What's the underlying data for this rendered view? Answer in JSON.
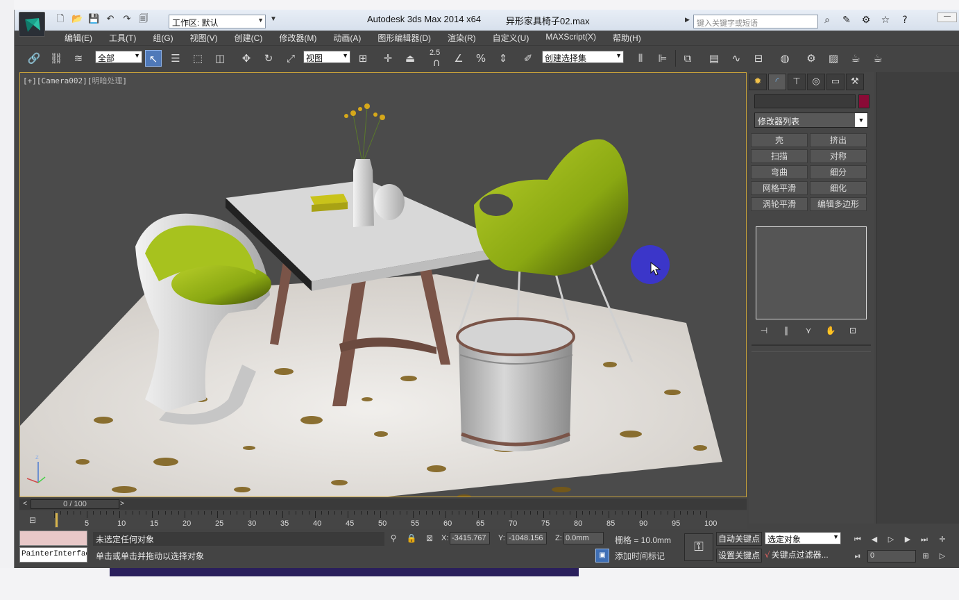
{
  "title": {
    "app": "Autodesk 3ds Max  2014 x64",
    "file": "异形家具椅子02.max",
    "workspace": "工作区: 默认",
    "search_placeholder": "键入关键字或短语",
    "min_label": "—"
  },
  "menu": [
    "编辑(E)",
    "工具(T)",
    "组(G)",
    "视图(V)",
    "创建(C)",
    "修改器(M)",
    "动画(A)",
    "图形编辑器(D)",
    "渲染(R)",
    "自定义(U)",
    "MAXScript(X)",
    "帮助(H)"
  ],
  "toolbar": {
    "filter": "全部",
    "ref_coord": "视图",
    "snap_value": "2.5",
    "selection_set": "创建选择集"
  },
  "viewport": {
    "label_open": "[+][Camera002][",
    "label_shade": "明暗处理",
    "label_close": "]"
  },
  "command_panel": {
    "modifier_list": "修改器列表",
    "modifiers": [
      "壳",
      "挤出",
      "扫描",
      "对称",
      "弯曲",
      "细分",
      "网格平滑",
      "细化",
      "涡轮平滑",
      "编辑多边形"
    ]
  },
  "timeline": {
    "position": "0 / 100",
    "ticks": [
      5,
      10,
      15,
      20,
      25,
      30,
      35,
      40,
      45,
      50,
      55,
      60,
      65,
      70,
      75,
      80,
      85,
      90,
      95,
      100
    ]
  },
  "status": {
    "listener": "PainterInterface",
    "prompt_selection": "未选定任何对象",
    "prompt_hint": "单击或单击并拖动以选择对象",
    "x_label": "X:",
    "x": "-3415.767",
    "y_label": "Y:",
    "y": "-1048.156",
    "z_label": "Z:",
    "z": "0.0mm",
    "grid": "栅格 = 10.0mm",
    "add_time_tag": "添加时间标记",
    "auto_key": "自动关键点",
    "set_key": "设置关键点",
    "key_filter": "关键点过滤器...",
    "selected_object": "选定对象",
    "current_frame": "0"
  },
  "colors": {
    "accent_active": "#4f79b9",
    "object_color": "#8a0a36",
    "viewport_border": "#c9a33a",
    "cursor_marker": "#3b36c9"
  }
}
